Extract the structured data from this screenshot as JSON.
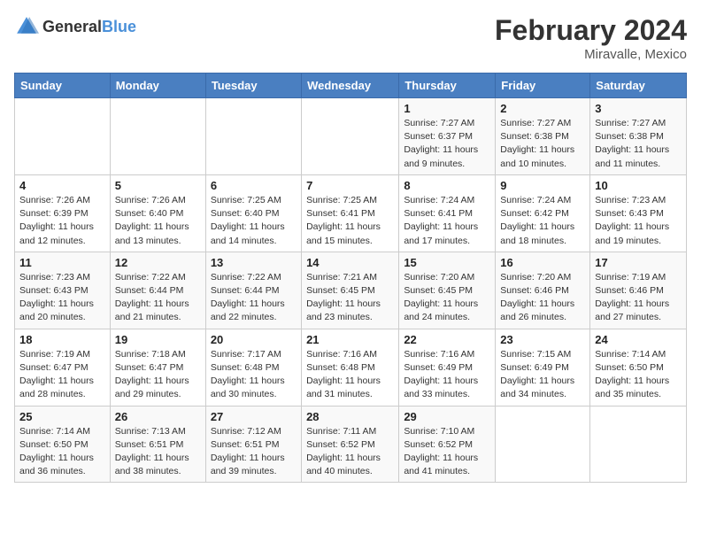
{
  "header": {
    "logo_general": "General",
    "logo_blue": "Blue",
    "title": "February 2024",
    "location": "Miravalle, Mexico"
  },
  "days_of_week": [
    "Sunday",
    "Monday",
    "Tuesday",
    "Wednesday",
    "Thursday",
    "Friday",
    "Saturday"
  ],
  "weeks": [
    [
      {
        "day": "",
        "info": ""
      },
      {
        "day": "",
        "info": ""
      },
      {
        "day": "",
        "info": ""
      },
      {
        "day": "",
        "info": ""
      },
      {
        "day": "1",
        "info": "Sunrise: 7:27 AM\nSunset: 6:37 PM\nDaylight: 11 hours and 9 minutes."
      },
      {
        "day": "2",
        "info": "Sunrise: 7:27 AM\nSunset: 6:38 PM\nDaylight: 11 hours and 10 minutes."
      },
      {
        "day": "3",
        "info": "Sunrise: 7:27 AM\nSunset: 6:38 PM\nDaylight: 11 hours and 11 minutes."
      }
    ],
    [
      {
        "day": "4",
        "info": "Sunrise: 7:26 AM\nSunset: 6:39 PM\nDaylight: 11 hours and 12 minutes."
      },
      {
        "day": "5",
        "info": "Sunrise: 7:26 AM\nSunset: 6:40 PM\nDaylight: 11 hours and 13 minutes."
      },
      {
        "day": "6",
        "info": "Sunrise: 7:25 AM\nSunset: 6:40 PM\nDaylight: 11 hours and 14 minutes."
      },
      {
        "day": "7",
        "info": "Sunrise: 7:25 AM\nSunset: 6:41 PM\nDaylight: 11 hours and 15 minutes."
      },
      {
        "day": "8",
        "info": "Sunrise: 7:24 AM\nSunset: 6:41 PM\nDaylight: 11 hours and 17 minutes."
      },
      {
        "day": "9",
        "info": "Sunrise: 7:24 AM\nSunset: 6:42 PM\nDaylight: 11 hours and 18 minutes."
      },
      {
        "day": "10",
        "info": "Sunrise: 7:23 AM\nSunset: 6:43 PM\nDaylight: 11 hours and 19 minutes."
      }
    ],
    [
      {
        "day": "11",
        "info": "Sunrise: 7:23 AM\nSunset: 6:43 PM\nDaylight: 11 hours and 20 minutes."
      },
      {
        "day": "12",
        "info": "Sunrise: 7:22 AM\nSunset: 6:44 PM\nDaylight: 11 hours and 21 minutes."
      },
      {
        "day": "13",
        "info": "Sunrise: 7:22 AM\nSunset: 6:44 PM\nDaylight: 11 hours and 22 minutes."
      },
      {
        "day": "14",
        "info": "Sunrise: 7:21 AM\nSunset: 6:45 PM\nDaylight: 11 hours and 23 minutes."
      },
      {
        "day": "15",
        "info": "Sunrise: 7:20 AM\nSunset: 6:45 PM\nDaylight: 11 hours and 24 minutes."
      },
      {
        "day": "16",
        "info": "Sunrise: 7:20 AM\nSunset: 6:46 PM\nDaylight: 11 hours and 26 minutes."
      },
      {
        "day": "17",
        "info": "Sunrise: 7:19 AM\nSunset: 6:46 PM\nDaylight: 11 hours and 27 minutes."
      }
    ],
    [
      {
        "day": "18",
        "info": "Sunrise: 7:19 AM\nSunset: 6:47 PM\nDaylight: 11 hours and 28 minutes."
      },
      {
        "day": "19",
        "info": "Sunrise: 7:18 AM\nSunset: 6:47 PM\nDaylight: 11 hours and 29 minutes."
      },
      {
        "day": "20",
        "info": "Sunrise: 7:17 AM\nSunset: 6:48 PM\nDaylight: 11 hours and 30 minutes."
      },
      {
        "day": "21",
        "info": "Sunrise: 7:16 AM\nSunset: 6:48 PM\nDaylight: 11 hours and 31 minutes."
      },
      {
        "day": "22",
        "info": "Sunrise: 7:16 AM\nSunset: 6:49 PM\nDaylight: 11 hours and 33 minutes."
      },
      {
        "day": "23",
        "info": "Sunrise: 7:15 AM\nSunset: 6:49 PM\nDaylight: 11 hours and 34 minutes."
      },
      {
        "day": "24",
        "info": "Sunrise: 7:14 AM\nSunset: 6:50 PM\nDaylight: 11 hours and 35 minutes."
      }
    ],
    [
      {
        "day": "25",
        "info": "Sunrise: 7:14 AM\nSunset: 6:50 PM\nDaylight: 11 hours and 36 minutes."
      },
      {
        "day": "26",
        "info": "Sunrise: 7:13 AM\nSunset: 6:51 PM\nDaylight: 11 hours and 38 minutes."
      },
      {
        "day": "27",
        "info": "Sunrise: 7:12 AM\nSunset: 6:51 PM\nDaylight: 11 hours and 39 minutes."
      },
      {
        "day": "28",
        "info": "Sunrise: 7:11 AM\nSunset: 6:52 PM\nDaylight: 11 hours and 40 minutes."
      },
      {
        "day": "29",
        "info": "Sunrise: 7:10 AM\nSunset: 6:52 PM\nDaylight: 11 hours and 41 minutes."
      },
      {
        "day": "",
        "info": ""
      },
      {
        "day": "",
        "info": ""
      }
    ]
  ]
}
